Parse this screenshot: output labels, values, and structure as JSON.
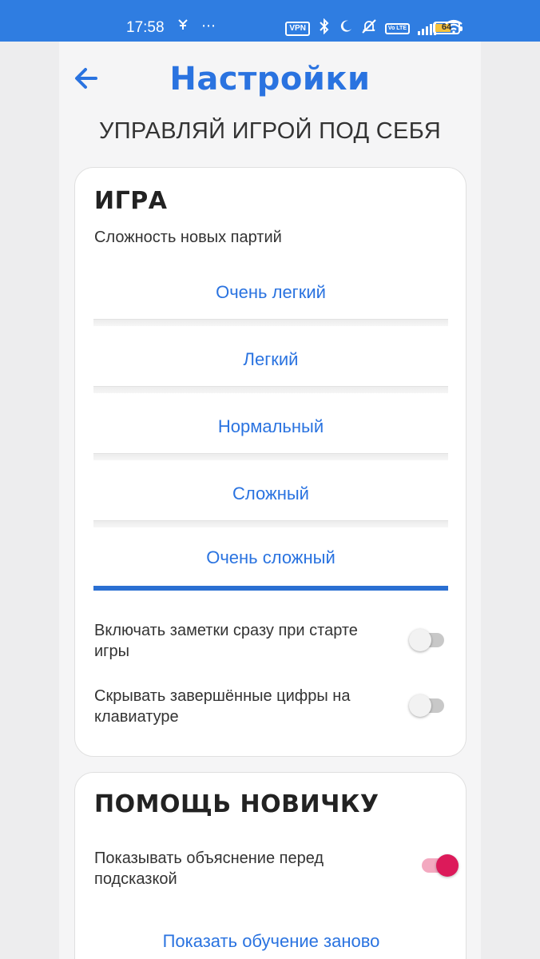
{
  "status_bar": {
    "time": "17:58",
    "extra_icons": "⋯",
    "vpn_label": "VPN",
    "volte_label": "Vo LTE",
    "battery": "64"
  },
  "header": {
    "title": "Настройки",
    "subtitle": "УПРАВЛЯЙ ИГРОЙ ПОД СЕБЯ"
  },
  "game_section": {
    "heading": "ИГРА",
    "difficulty_label": "Сложность новых партий",
    "difficulties": [
      {
        "label": "Очень легкий",
        "selected": false
      },
      {
        "label": "Легкий",
        "selected": false
      },
      {
        "label": "Нормальный",
        "selected": false
      },
      {
        "label": "Сложный",
        "selected": false
      },
      {
        "label": "Очень сложный",
        "selected": true
      }
    ],
    "settings": [
      {
        "label": "Включать заметки сразу при старте игры",
        "enabled": false
      },
      {
        "label": "Скрывать завершённые цифры на клавиатуре",
        "enabled": false
      }
    ]
  },
  "help_section": {
    "heading": "ПОМОЩЬ НОВИЧКУ",
    "settings": [
      {
        "label": "Показывать объяснение перед подсказкой",
        "enabled": true
      }
    ],
    "show_tutorial_label": "Показать обучение заново"
  },
  "colors": {
    "accent": "#2a73e0",
    "status_bar": "#2f7de1",
    "toggle_on": "#dc1a5a",
    "selected_underline": "#2a6fd2"
  }
}
